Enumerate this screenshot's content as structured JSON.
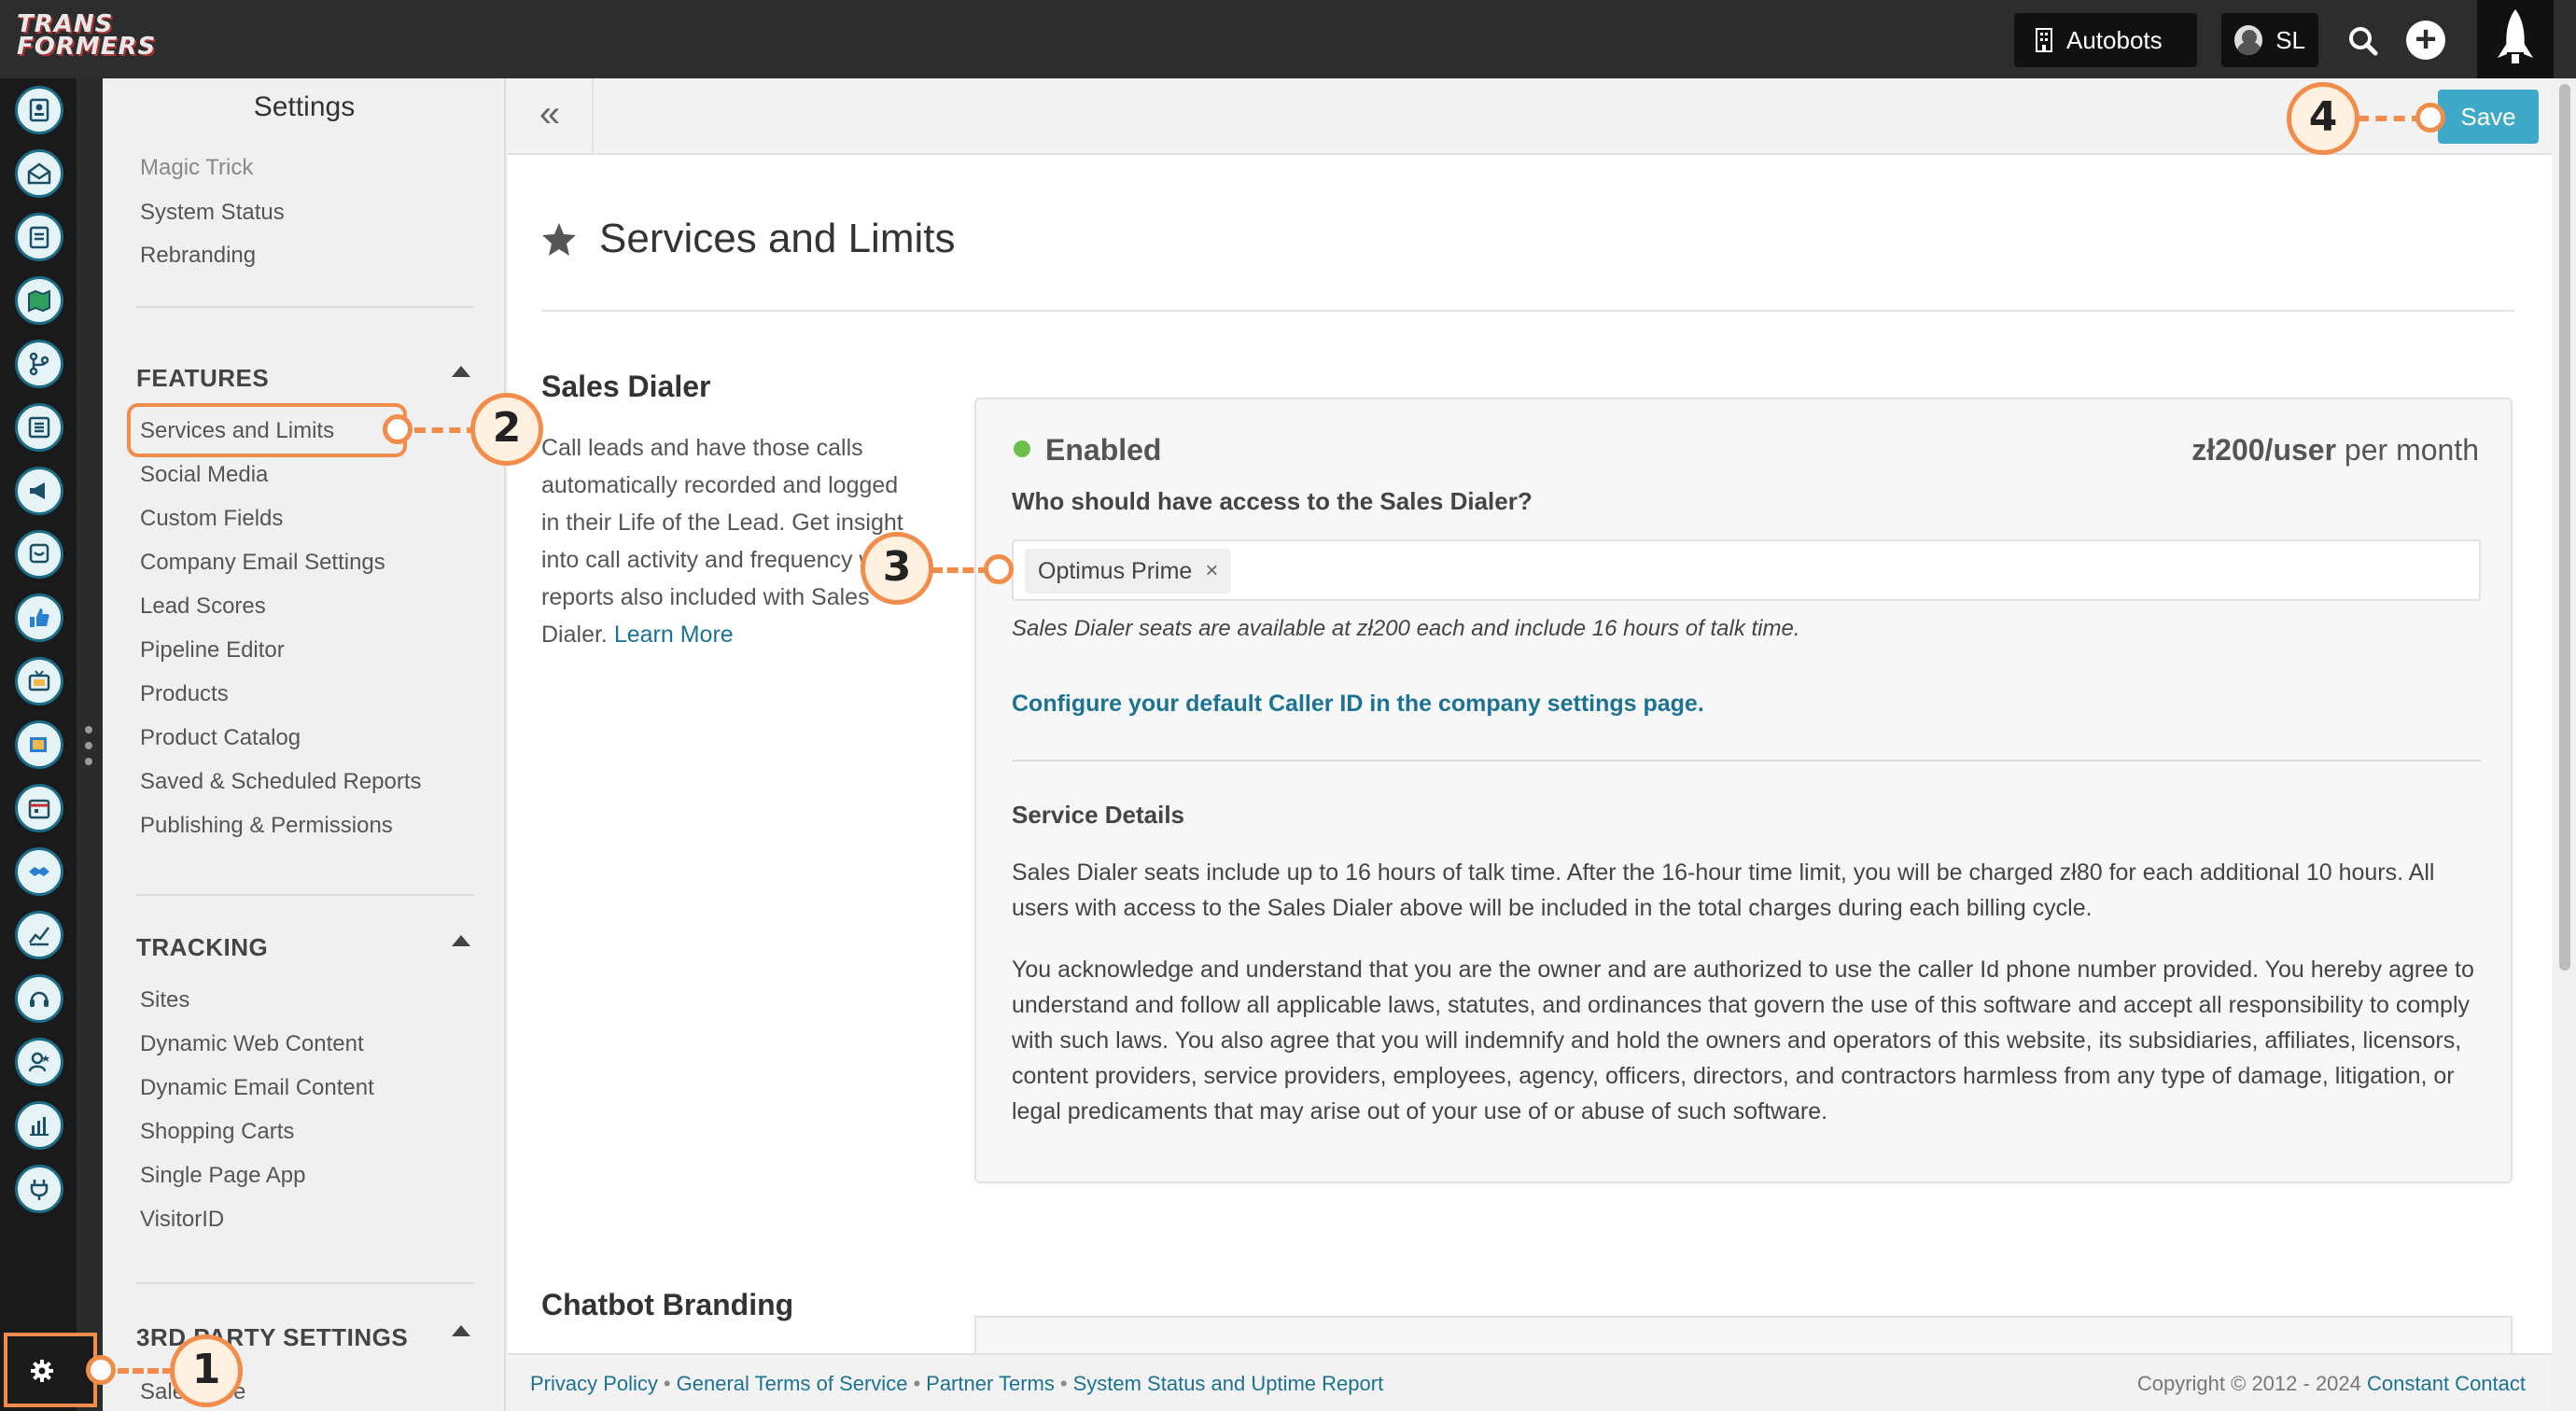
{
  "app": {
    "logo_line1": "TRANS",
    "logo_line2": "FORMERS",
    "account_button": "Autobots",
    "user_initials": "SL"
  },
  "sidebar": {
    "title": "Settings",
    "top_links": [
      "Magic Trick",
      "System Status",
      "Rebranding"
    ],
    "features_heading": "FEATURES",
    "features": [
      "Services and Limits",
      "Social Media",
      "Custom Fields",
      "Company Email Settings",
      "Lead Scores",
      "Pipeline Editor",
      "Products",
      "Product Catalog",
      "Saved & Scheduled Reports",
      "Publishing & Permissions"
    ],
    "tracking_heading": "TRACKING",
    "tracking": [
      "Sites",
      "Dynamic Web Content",
      "Dynamic Email Content",
      "Shopping Carts",
      "Single Page App",
      "VisitorID"
    ],
    "third_party_heading": "3RD PARTY SETTINGS",
    "third_party_first": "Salesforce"
  },
  "toolbar": {
    "collapse_label": "«",
    "save_label": "Save"
  },
  "page": {
    "title": "Services and Limits"
  },
  "sales_dialer": {
    "heading": "Sales Dialer",
    "description": "Call leads and have those calls automatically recorded and logged in their Life of the Lead. Get insight into call activity and frequency with reports also included with Sales Dialer.",
    "learn_more": "Learn More",
    "status": "Enabled",
    "price": "zł200/user",
    "price_period": "per month",
    "access_question": "Who should have access to the Sales Dialer?",
    "selected_users": [
      "Optimus Prime"
    ],
    "seats_note": "Sales Dialer seats are available at zł200 each and include 16 hours of talk time.",
    "caller_id_link": "Configure your default Caller ID in the company settings page.",
    "service_details_heading": "Service Details",
    "service_details_p1": "Sales Dialer seats include up to 16 hours of talk time. After the 16-hour time limit, you will be charged zł80 for each additional 10 hours. All users with access to the Sales Dialer above will be included in the total charges during each billing cycle.",
    "service_details_p2": "You acknowledge and understand that you are the owner and are authorized to use the caller Id phone number provided. You hereby agree to understand and follow all applicable laws, statutes, and ordinances that govern the use of this software and accept all responsibility to comply with such laws. You also agree that you will indemnify and hold the owners and operators of this website, its subsidiaries, affiliates, licensors, content providers, service providers, employees, agency, officers, directors, and contractors harmless from any type of damage, litigation, or legal predicaments that may arise out of your use of or abuse of such software."
  },
  "chatbot": {
    "heading": "Chatbot Branding"
  },
  "footer": {
    "links": [
      "Privacy Policy",
      "General Terms of Service",
      "Partner Terms",
      "System Status and Uptime Report"
    ],
    "copyright": "Copyright © 2012 - 2024",
    "company": "Constant Contact"
  },
  "annotations": [
    "1",
    "2",
    "3",
    "4"
  ],
  "colors": {
    "accent": "#3ea9c9",
    "link": "#1b7293",
    "callout": "#f28c4a",
    "enabled": "#6cc04a",
    "topbar": "#2d2d2d"
  }
}
